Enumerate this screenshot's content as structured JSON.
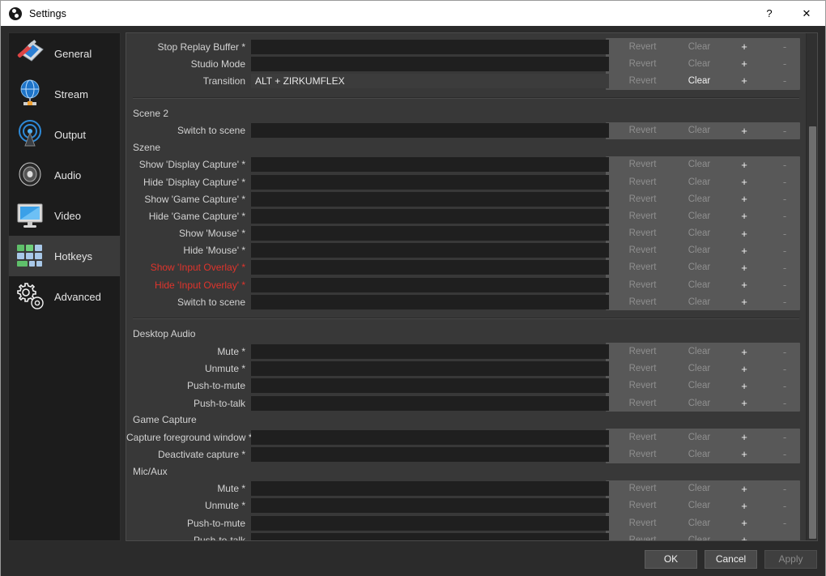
{
  "window": {
    "title": "Settings",
    "logo_icon": "obs-logo-icon",
    "help_glyph": "?",
    "close_glyph": "✕"
  },
  "sidebar": {
    "items": [
      {
        "label": "General",
        "icon": "general-icon",
        "selected": false
      },
      {
        "label": "Stream",
        "icon": "stream-icon",
        "selected": false
      },
      {
        "label": "Output",
        "icon": "output-icon",
        "selected": false
      },
      {
        "label": "Audio",
        "icon": "audio-icon",
        "selected": false
      },
      {
        "label": "Video",
        "icon": "video-icon",
        "selected": false
      },
      {
        "label": "Hotkeys",
        "icon": "hotkeys-icon",
        "selected": true
      },
      {
        "label": "Advanced",
        "icon": "advanced-icon",
        "selected": false
      }
    ]
  },
  "buttons": {
    "revert": "Revert",
    "clear": "Clear",
    "add": "+",
    "remove": "-"
  },
  "colors": {
    "background": "#383838",
    "field": "#1f1f1f",
    "panel": "#585858",
    "alert_label": "#e0342c",
    "sidebar": "#1c1c1c",
    "titlebar": "#ffffff"
  },
  "content": {
    "groups": [
      {
        "title": null,
        "separator_after": true,
        "rows": [
          {
            "label": "Stop Replay Buffer *",
            "value": "",
            "alert": false,
            "clear_enabled": false
          },
          {
            "label": "Studio Mode",
            "value": "",
            "alert": false,
            "clear_enabled": false
          },
          {
            "label": "Transition",
            "value": "ALT + ZIRKUMFLEX",
            "alert": false,
            "clear_enabled": true
          }
        ]
      },
      {
        "title": "Scene 2",
        "separator_after": false,
        "rows": [
          {
            "label": "Switch to scene",
            "value": "",
            "alert": false,
            "clear_enabled": false
          }
        ]
      },
      {
        "title": "Szene",
        "separator_after": true,
        "rows": [
          {
            "label": "Show 'Display Capture' *",
            "value": "",
            "alert": false,
            "clear_enabled": false
          },
          {
            "label": "Hide 'Display Capture' *",
            "value": "",
            "alert": false,
            "clear_enabled": false
          },
          {
            "label": "Show 'Game Capture' *",
            "value": "",
            "alert": false,
            "clear_enabled": false
          },
          {
            "label": "Hide 'Game Capture' *",
            "value": "",
            "alert": false,
            "clear_enabled": false
          },
          {
            "label": "Show 'Mouse' *",
            "value": "",
            "alert": false,
            "clear_enabled": false
          },
          {
            "label": "Hide 'Mouse' *",
            "value": "",
            "alert": false,
            "clear_enabled": false
          },
          {
            "label": "Show 'Input Overlay' *",
            "value": "",
            "alert": true,
            "clear_enabled": false
          },
          {
            "label": "Hide 'Input Overlay' *",
            "value": "",
            "alert": true,
            "clear_enabled": false
          },
          {
            "label": "Switch to scene",
            "value": "",
            "alert": false,
            "clear_enabled": false
          }
        ]
      },
      {
        "title": "Desktop Audio",
        "separator_after": false,
        "rows": [
          {
            "label": "Mute *",
            "value": "",
            "alert": false,
            "clear_enabled": false
          },
          {
            "label": "Unmute *",
            "value": "",
            "alert": false,
            "clear_enabled": false
          },
          {
            "label": "Push-to-mute",
            "value": "",
            "alert": false,
            "clear_enabled": false
          },
          {
            "label": "Push-to-talk",
            "value": "",
            "alert": false,
            "clear_enabled": false
          }
        ]
      },
      {
        "title": "Game Capture",
        "separator_after": false,
        "rows": [
          {
            "label": "Capture foreground window *",
            "value": "",
            "alert": false,
            "clear_enabled": false
          },
          {
            "label": "Deactivate capture *",
            "value": "",
            "alert": false,
            "clear_enabled": false
          }
        ]
      },
      {
        "title": "Mic/Aux",
        "separator_after": false,
        "rows": [
          {
            "label": "Mute *",
            "value": "",
            "alert": false,
            "clear_enabled": false
          },
          {
            "label": "Unmute *",
            "value": "",
            "alert": false,
            "clear_enabled": false
          },
          {
            "label": "Push-to-mute",
            "value": "",
            "alert": false,
            "clear_enabled": false
          },
          {
            "label": "Push-to-talk",
            "value": "",
            "alert": false,
            "clear_enabled": false
          }
        ]
      }
    ]
  },
  "footer": {
    "ok": "OK",
    "cancel": "Cancel",
    "apply": "Apply",
    "apply_enabled": false
  }
}
